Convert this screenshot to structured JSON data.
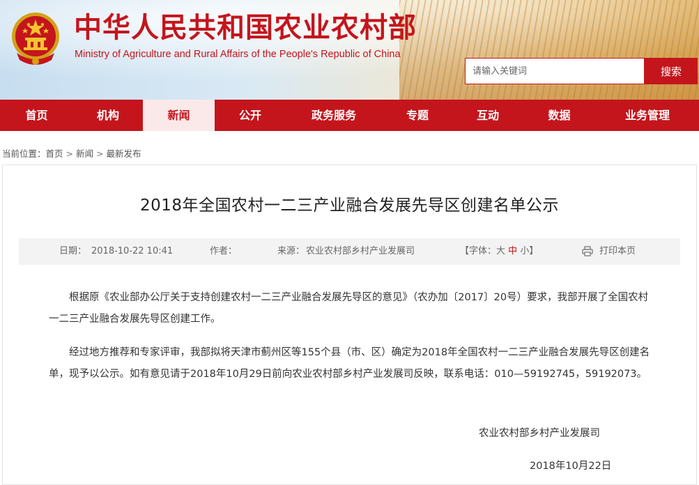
{
  "header": {
    "title_cn": "中华人民共和国农业农村部",
    "title_en": "Ministry of Agriculture and Rural Affairs of the People's Republic of China",
    "emblem_icon": "national-emblem-icon",
    "brand_color": "#c4151c"
  },
  "search": {
    "placeholder": "请输入关键词",
    "button_label": "搜索"
  },
  "nav": {
    "items": [
      {
        "label": "首页"
      },
      {
        "label": "机构"
      },
      {
        "label": "新闻",
        "active": true
      },
      {
        "label": "公开"
      },
      {
        "label": "政务服务"
      },
      {
        "label": "专题"
      },
      {
        "label": "互动"
      },
      {
        "label": "数据"
      },
      {
        "label": "业务管理"
      }
    ]
  },
  "breadcrumb": {
    "prefix": "当前位置：",
    "items": [
      "首页",
      "新闻",
      "最新发布"
    ],
    "separator": ">"
  },
  "article": {
    "title": "2018年全国农村一二三产业融合发展先导区创建名单公示",
    "meta": {
      "date_label": "日期：",
      "date": "2018-10-22 10:41",
      "author_label": "作者：",
      "author": "",
      "source_label": "来源：",
      "source": "农业农村部乡村产业发展司",
      "font_label": "【字体：",
      "font_large": "大",
      "font_medium": "中",
      "font_small": "小",
      "font_close": "】",
      "print_label": "打印本页",
      "print_icon": "printer-icon"
    },
    "paragraphs": [
      "根据原《农业部办公厅关于支持创建农村一二三产业融合发展先导区的意见》（农办加〔2017〕20号）要求，我部开展了全国农村一二三产业融合发展先导区创建工作。",
      "经过地方推荐和专家评审，我部拟将天津市蓟州区等155个县（市、区）确定为2018年全国农村一二三产业融合发展先导区创建名单，现予以公示。如有意见请于2018年10月29日前向农业农村部乡村产业发展司反映，联系电话：010—59192745，59192073。"
    ],
    "signature": "农业农村部乡村产业发展司",
    "sign_date": "2018年10月22日"
  }
}
